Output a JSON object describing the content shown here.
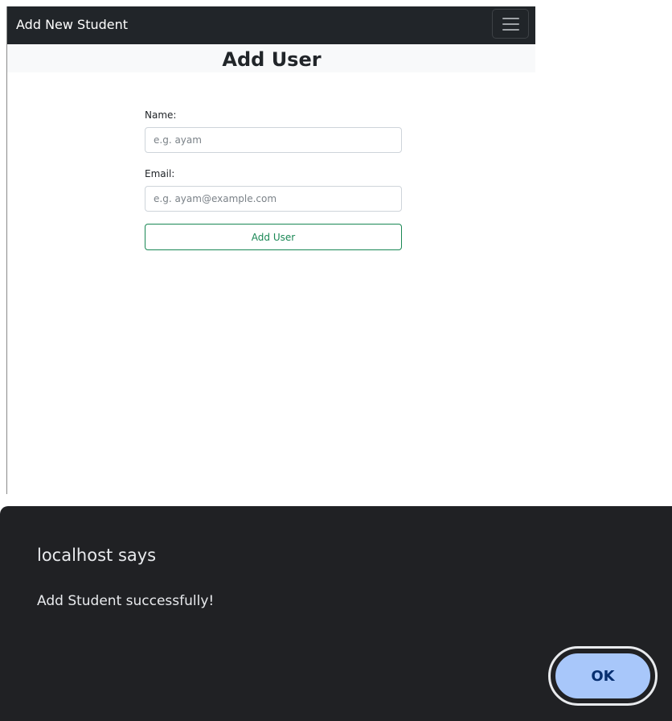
{
  "navbar": {
    "brand": "Add New Student",
    "toggler_icon": "hamburger-menu-icon"
  },
  "form": {
    "title": "Add User",
    "name_label": "Name:",
    "name_placeholder": "e.g. ayam",
    "name_value": "",
    "email_label": "Email:",
    "email_placeholder": "e.g. ayam@example.com",
    "email_value": "",
    "submit_label": "Add User"
  },
  "dialog": {
    "title": "localhost says",
    "message": "Add Student successfully!",
    "ok_label": "OK"
  },
  "colors": {
    "navbar_bg": "#212529",
    "success_green": "#198754",
    "dialog_bg": "#202124",
    "ok_button_bg": "#a8c7fa",
    "ok_button_text": "#062e6f"
  }
}
